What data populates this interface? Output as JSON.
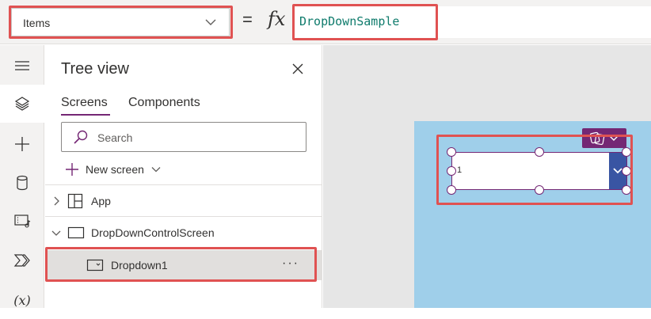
{
  "formula_bar": {
    "property": "Items",
    "equals": "=",
    "fx": "fx",
    "formula": "DropDownSample"
  },
  "rail": {
    "icons": [
      "hamburger-menu-icon",
      "layers-icon",
      "plus-icon",
      "database-icon",
      "media-icon",
      "power-automate-icon",
      "variables-icon"
    ],
    "variables_label": "(x)"
  },
  "tree_view": {
    "title": "Tree view",
    "tabs": {
      "screens": "Screens",
      "components": "Components"
    },
    "search_placeholder": "Search",
    "new_screen": "New screen",
    "items": {
      "app": "App",
      "screen": "DropDownControlScreen",
      "dropdown": "Dropdown1"
    },
    "more": "···"
  },
  "canvas": {
    "dropdown_value": "1"
  },
  "colors": {
    "accent": "#742774",
    "highlight": "#e05252",
    "formula_text": "#0f7b6c",
    "screen_bg": "#9fcfea",
    "dropdown_chevron_bg": "#3955a3"
  }
}
